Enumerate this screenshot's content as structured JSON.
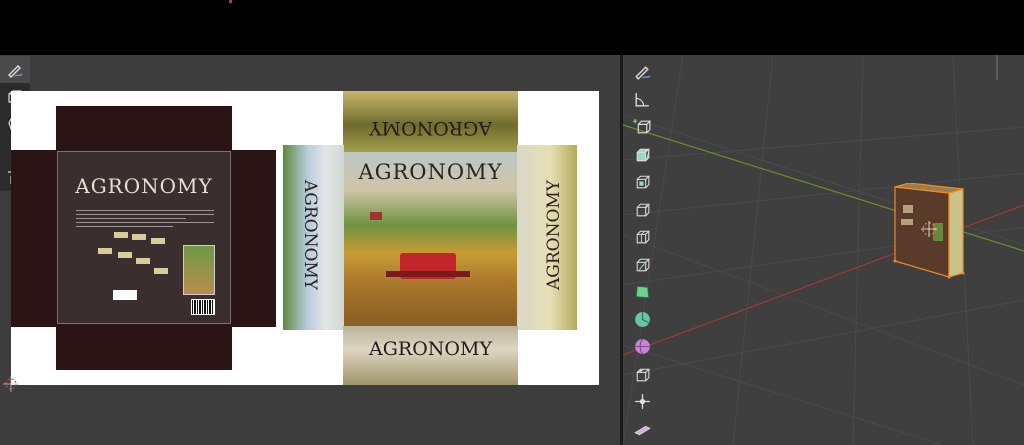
{
  "uv_editor": {
    "tools": [
      "annotate-icon",
      "uv-select-box-icon",
      "lasso-icon",
      "grab-icon",
      "tweak-icon"
    ],
    "back_title": "AGRONOMY",
    "front_title": "AGRONOMY",
    "right_spine_title": "AGRONOMY",
    "left_spine_title": "AGRONOMY",
    "top_flap_title": "AGRONOMY",
    "bottom_flap_title": "AGRONOMY"
  },
  "viewport": {
    "tools": [
      "annotate-icon",
      "measure-icon",
      "add-cube-icon",
      "extrude-icon",
      "inset-icon",
      "bevel-icon",
      "loop-cut-icon",
      "knife-icon",
      "poly-build-icon",
      "spin-icon",
      "smooth-icon",
      "edge-slide-icon",
      "shrink-fatten-icon",
      "shear-icon"
    ],
    "colors": {
      "x_axis": "#a03a3a",
      "y_axis": "#6b8f2a",
      "selection": "#f08a24"
    }
  }
}
